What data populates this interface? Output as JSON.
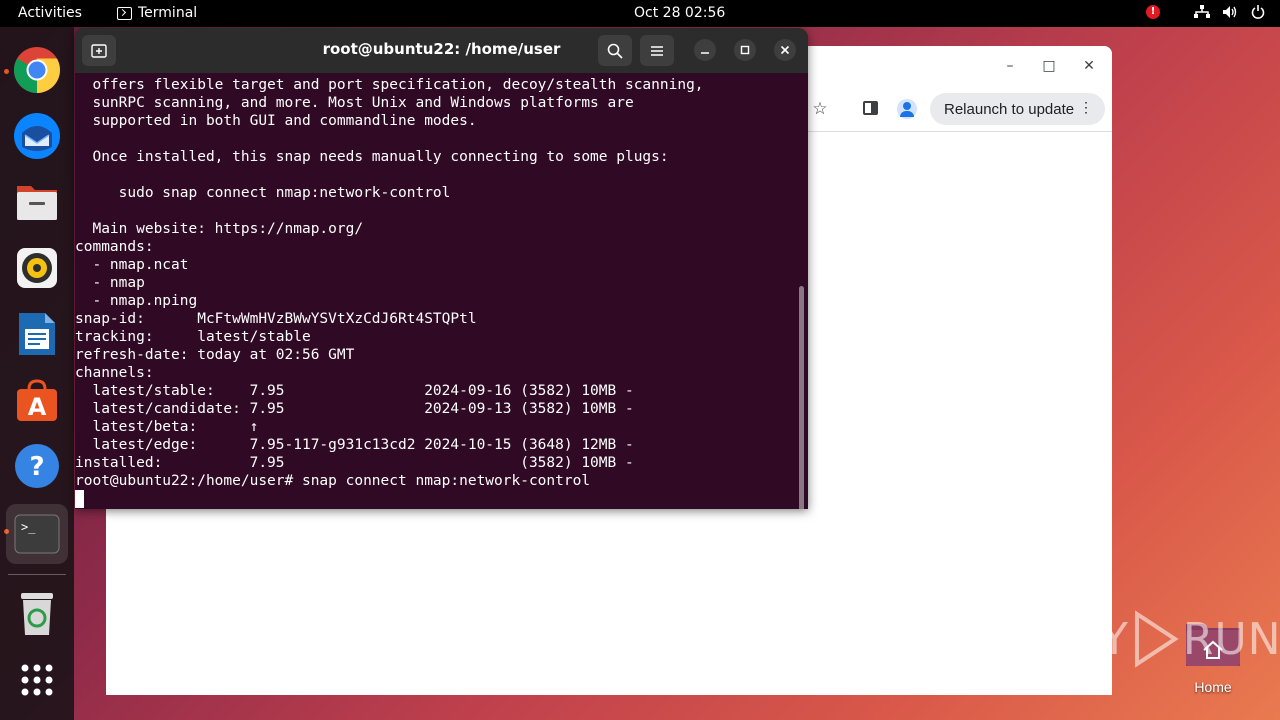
{
  "topbar": {
    "activities": "Activities",
    "app_name": "Terminal",
    "clock": "Oct 28  02:56",
    "alert": "!"
  },
  "dock": {
    "items": [
      {
        "name": "Google Chrome",
        "icon": "chrome-icon",
        "running": true
      },
      {
        "name": "Thunderbird",
        "icon": "thunderbird-icon",
        "running": false
      },
      {
        "name": "Files",
        "icon": "files-icon",
        "running": false
      },
      {
        "name": "Rhythmbox",
        "icon": "rhythmbox-icon",
        "running": false
      },
      {
        "name": "LibreOffice Writer",
        "icon": "writer-icon",
        "running": false
      },
      {
        "name": "Ubuntu Software",
        "icon": "software-icon",
        "running": false
      },
      {
        "name": "Help",
        "icon": "help-icon",
        "running": false
      },
      {
        "name": "Terminal",
        "icon": "terminal-icon",
        "running": true
      },
      {
        "name": "Trash",
        "icon": "trash-icon",
        "running": false
      },
      {
        "name": "Show Applications",
        "icon": "app-grid-icon",
        "running": false
      }
    ]
  },
  "browser": {
    "relaunch_label": "Relaunch to update",
    "colors": {
      "chip": "#e8eaed",
      "profile": "#1a73e8"
    }
  },
  "terminal": {
    "title": "root@ubuntu22: /home/user",
    "lines": [
      "  offers flexible target and port specification, decoy/stealth scanning,",
      "  sunRPC scanning, and more. Most Unix and Windows platforms are",
      "  supported in both GUI and commandline modes.",
      "",
      "  Once installed, this snap needs manually connecting to some plugs:",
      "",
      "     sudo snap connect nmap:network-control",
      "",
      "  Main website: https://nmap.org/",
      "commands:",
      "  - nmap.ncat",
      "  - nmap",
      "  - nmap.nping",
      "snap-id:      McFtwWmHVzBWwYSVtXzCdJ6Rt4STQPtl",
      "tracking:     latest/stable",
      "refresh-date: today at 02:56 GMT",
      "channels:",
      "  latest/stable:    7.95                2024-09-16 (3582) 10MB -",
      "  latest/candidate: 7.95                2024-09-13 (3582) 10MB -",
      "  latest/beta:      ↑",
      "  latest/edge:      7.95-117-g931c13cd2 2024-10-15 (3648) 12MB -",
      "installed:          7.95                           (3582) 10MB -",
      "root@ubuntu22:/home/user# snap connect nmap:network-control"
    ],
    "colors": {
      "background": "#300a24",
      "headerbar": "#2c2c2c"
    }
  },
  "desktop": {
    "home_label": "Home",
    "watermark": {
      "left": "ANY",
      "right": "RUN"
    }
  }
}
